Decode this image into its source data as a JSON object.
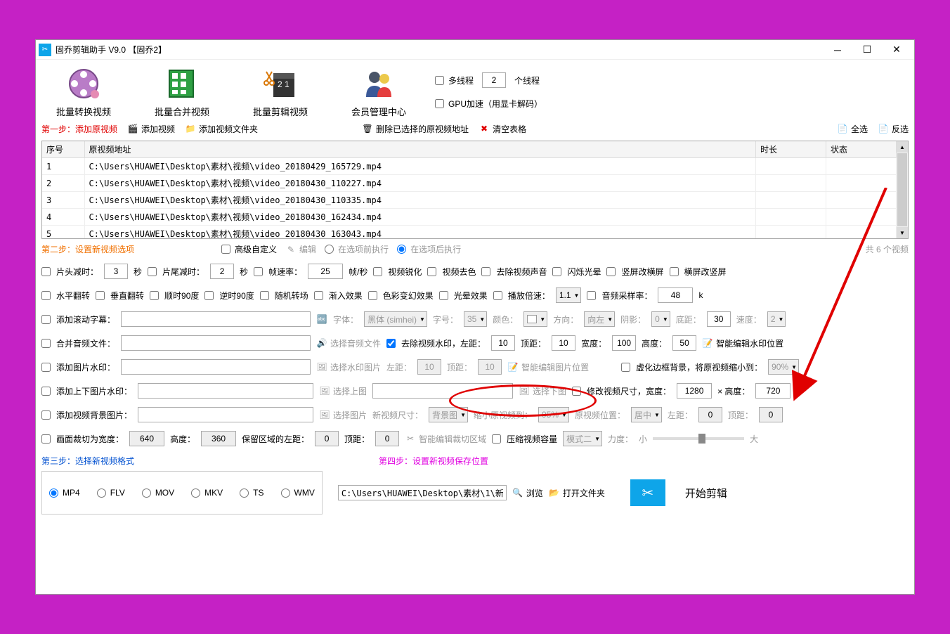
{
  "title": "固乔剪辑助手 V9.0 【固乔2】",
  "toolbar": {
    "convert": "批量转换视频",
    "merge": "批量合并视频",
    "edit": "批量剪辑视频",
    "member": "会员管理中心",
    "multithread": "多线程",
    "thread_count": "2",
    "thread_unit": "个线程",
    "gpu": "GPU加速（用显卡解码）"
  },
  "step1": {
    "label": "第一步：添加原视频",
    "add_video": "添加视频",
    "add_folder": "添加视频文件夹",
    "delete_selected": "删除已选择的原视频地址",
    "clear_table": "清空表格",
    "select_all": "全选",
    "invert": "反选"
  },
  "table": {
    "headers": {
      "seq": "序号",
      "path": "原视频地址",
      "duration": "时长",
      "status": "状态"
    },
    "rows": [
      {
        "seq": "1",
        "path": "C:\\Users\\HUAWEI\\Desktop\\素材\\视频\\video_20180429_165729.mp4"
      },
      {
        "seq": "2",
        "path": "C:\\Users\\HUAWEI\\Desktop\\素材\\视频\\video_20180430_110227.mp4"
      },
      {
        "seq": "3",
        "path": "C:\\Users\\HUAWEI\\Desktop\\素材\\视频\\video_20180430_110335.mp4"
      },
      {
        "seq": "4",
        "path": "C:\\Users\\HUAWEI\\Desktop\\素材\\视频\\video_20180430_162434.mp4"
      },
      {
        "seq": "5",
        "path": "C:\\Users\\HUAWEI\\Desktop\\素材\\视频\\video_20180430_163043.mp4"
      }
    ]
  },
  "step2": {
    "label": "第二步：设置新视频选项",
    "advanced": "高级自定义",
    "edit_opt": "编辑",
    "before": "在选项前执行",
    "after": "在选项后执行",
    "total": "共 6 个视频"
  },
  "opts": {
    "trim_head": "片头减时：",
    "trim_head_val": "3",
    "sec1": "秒",
    "trim_tail": "片尾减时：",
    "trim_tail_val": "2",
    "sec2": "秒",
    "fps": "帧速率：",
    "fps_val": "25",
    "fps_unit": "帧/秒",
    "sharpen": "视频锐化",
    "desaturate": "视频去色",
    "remove_audio": "去除视频声音",
    "flash": "闪烁光晕",
    "v2h": "竖屏改横屏",
    "h2v": "横屏改竖屏",
    "hflip": "水平翻转",
    "vflip": "垂直翻转",
    "cw90": "顺时90度",
    "ccw90": "逆时90度",
    "random_trans": "随机转场",
    "cut_in": "渐入效果",
    "color_shift": "色彩变幻效果",
    "halo": "光晕效果",
    "speed": "播放倍速：",
    "speed_val": "1.1",
    "audio_rate": "音频采样率：",
    "audio_rate_val": "48",
    "audio_rate_unit": "k",
    "scroll_sub": "添加滚动字幕：",
    "font": "字体：",
    "font_val": "黑体 (simhei)",
    "size": "字号：",
    "size_val": "35",
    "color": "颜色：",
    "direction": "方向：",
    "direction_val": "向左",
    "shadow": "阴影：",
    "shadow_val": "0",
    "bottom": "底距：",
    "bottom_val": "30",
    "speed2": "速度：",
    "speed2_val": "2",
    "merge_audio": "合并音频文件：",
    "select_audio": "选择音频文件",
    "remove_wm": "去除视频水印，左距：",
    "wm_left": "10",
    "wm_top_lbl": "顶距：",
    "wm_top": "10",
    "wm_w_lbl": "宽度：",
    "wm_w": "100",
    "wm_h_lbl": "高度：",
    "wm_h": "50",
    "smart_wm": "智能编辑水印位置",
    "add_img_wm": "添加图片水印：",
    "select_wm_img": "选择水印图片",
    "left2": "左距：",
    "left2_val": "10",
    "top2": "顶距：",
    "top2_val": "10",
    "smart_img": "智能编辑图片位置",
    "blur_border": "虚化边框背景，将原视频缩小到：",
    "blur_pct": "90%",
    "add_tb_img": "添加上下图片水印：",
    "select_top": "选择上图",
    "select_bottom": "选择下图",
    "resize": "修改视频尺寸，宽度：",
    "resize_w": "1280",
    "resize_x": "× 高度：",
    "resize_h": "720",
    "add_bg": "添加视频背景图片：",
    "select_img": "选择图片",
    "new_size": "新视频尺寸：",
    "new_size_val": "背景图",
    "shrink_orig": "缩小原视频到：",
    "shrink_val": "95%",
    "orig_pos": "原视频位置：",
    "orig_pos_val": "居中",
    "left3": "左距：",
    "left3_val": "0",
    "top3": "顶距：",
    "top3_val": "0",
    "crop_w": "画面裁切为宽度：",
    "crop_w_val": "640",
    "crop_h": "高度：",
    "crop_h_val": "360",
    "crop_left": "保留区域的左距：",
    "crop_left_val": "0",
    "crop_top": "顶距：",
    "crop_top_val": "0",
    "smart_crop": "智能编辑裁切区域",
    "compress": "压缩视频容量",
    "compress_mode": "模式二",
    "strength": "力度：",
    "strength_low": "小",
    "strength_high": "大"
  },
  "step3": {
    "label": "第三步：选择新视频格式"
  },
  "step4": {
    "label": "第四步：设置新视频保存位置"
  },
  "formats": {
    "mp4": "MP4",
    "flv": "FLV",
    "mov": "MOV",
    "mkv": "MKV",
    "ts": "TS",
    "wmv": "WMV"
  },
  "save": {
    "path": "C:\\Users\\HUAWEI\\Desktop\\素材\\1\\新",
    "browse": "浏览",
    "open_folder": "打开文件夹",
    "start": "开始剪辑"
  }
}
